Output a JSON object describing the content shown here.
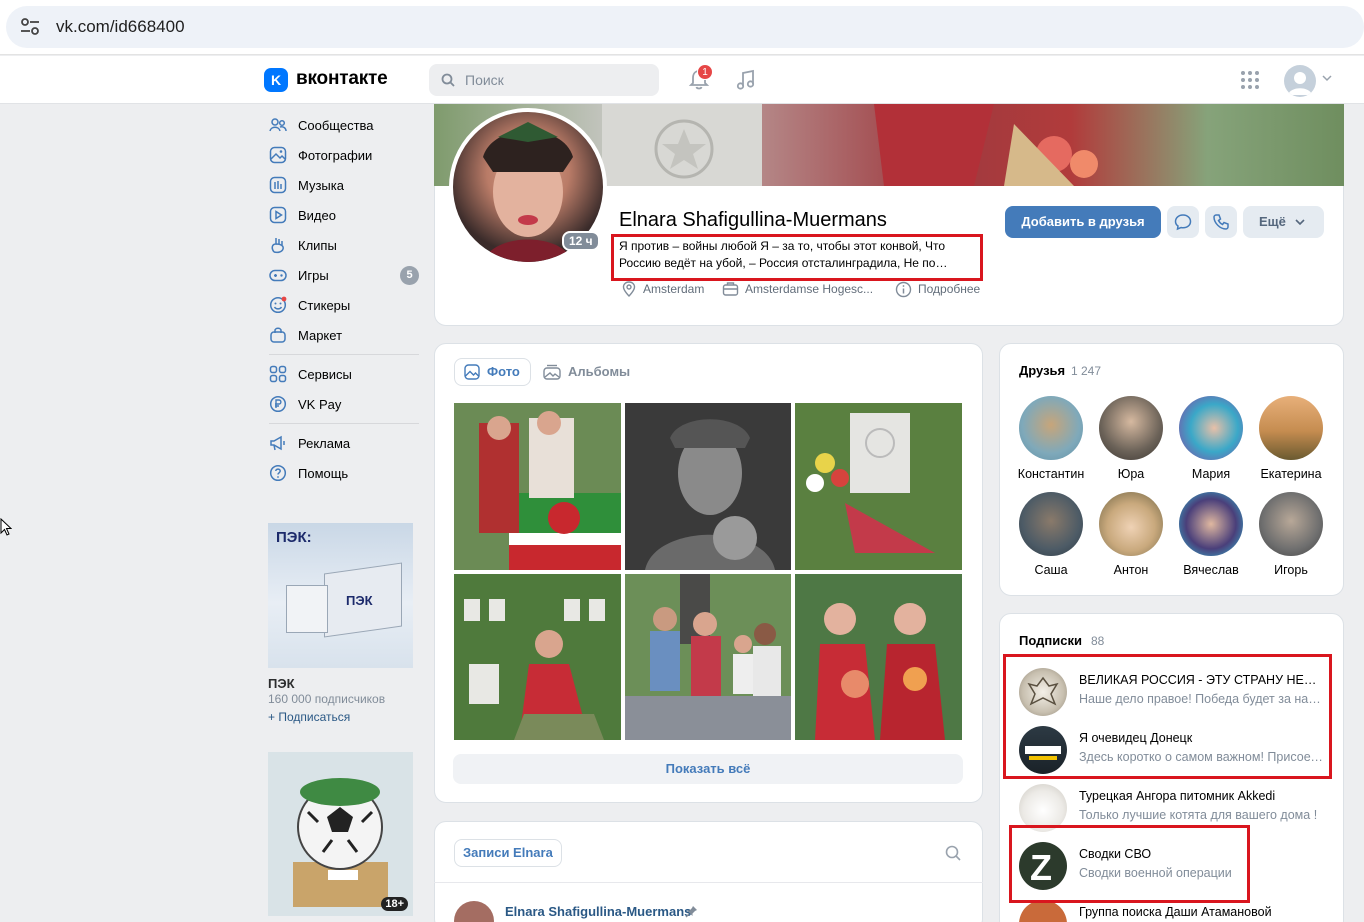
{
  "browser": {
    "url": "vk.com/id668400"
  },
  "header": {
    "logo_text": "вконтакте",
    "logo_letter": "K",
    "search_placeholder": "Поиск",
    "notifications_count": "1"
  },
  "sidebar": {
    "items": [
      {
        "label": "Сообщества",
        "icon": "communities-icon"
      },
      {
        "label": "Фотографии",
        "icon": "photos-icon"
      },
      {
        "label": "Музыка",
        "icon": "music-icon"
      },
      {
        "label": "Видео",
        "icon": "video-icon"
      },
      {
        "label": "Клипы",
        "icon": "clips-icon"
      },
      {
        "label": "Игры",
        "icon": "games-icon",
        "count": "5"
      },
      {
        "label": "Стикеры",
        "icon": "stickers-icon"
      },
      {
        "label": "Маркет",
        "icon": "market-icon"
      }
    ],
    "items2": [
      {
        "label": "Сервисы",
        "icon": "services-icon"
      },
      {
        "label": "VK Pay",
        "icon": "vkpay-icon"
      }
    ],
    "items3": [
      {
        "label": "Реклама",
        "icon": "ads-icon"
      },
      {
        "label": "Помощь",
        "icon": "help-icon"
      }
    ]
  },
  "ads": {
    "ad1_logo": "ПЭК:",
    "ad1_truck": "ПЭК",
    "ad1_title": "ПЭК",
    "ad1_subscribers": "160 000 подписчиков",
    "ad1_subscribe": "+ Подписаться",
    "ad2_badge": "18+"
  },
  "profile": {
    "name": "Elnara Shafigullina-Muermans",
    "status": "Я против – войны любой Я – за то, чтобы этот конвой, Что Россию ведёт на убой, – Россия отсталинградила, Не по…",
    "online": "12 ч",
    "city": "Amsterdam",
    "education": "Amsterdamse Hogesc...",
    "more_info": "Подробнее",
    "add_friend": "Добавить в друзья",
    "more": "Ещё"
  },
  "photos": {
    "tab_photos": "Фото",
    "tab_albums": "Альбомы",
    "show_all": "Показать всё"
  },
  "wall": {
    "tab": "Записи Elnara",
    "post_author": "Elnara Shafigullina-Muermans"
  },
  "friends": {
    "title": "Друзья",
    "count": "1 247",
    "list": [
      {
        "name": "Константин",
        "color": "#5f8fa6"
      },
      {
        "name": "Юра",
        "color": "#6b6258"
      },
      {
        "name": "Мария",
        "color": "#3aa8c8"
      },
      {
        "name": "Екатерина",
        "color": "#c58c50"
      },
      {
        "name": "Саша",
        "color": "#4d5b66"
      },
      {
        "name": "Антон",
        "color": "#c9a97d"
      },
      {
        "name": "Вячеслав",
        "color": "#4a3f7a"
      },
      {
        "name": "Игорь",
        "color": "#6f6f6f"
      }
    ]
  },
  "subscriptions": {
    "title": "Подписки",
    "count": "88",
    "list": [
      {
        "title": "ВЕЛИКАЯ РОССИЯ - ЭТУ СТРАНУ НЕ ПОБЕДИТЬ",
        "subtitle": "Наше дело правое! Победа будет за нами!"
      },
      {
        "title": "Я очевидец Донецк",
        "subtitle": "Здесь коротко о самом важном! Присоединяйтесь"
      },
      {
        "title": "Турецкая Ангора питомник Akkedi",
        "subtitle": "Только лучшие котята для вашего дома !"
      },
      {
        "title": "Сводки СВО",
        "subtitle": "Сводки военной операции"
      },
      {
        "title": "Группа поиска Даши Атамановой",
        "subtitle": ""
      }
    ],
    "z_letter": "Z"
  }
}
